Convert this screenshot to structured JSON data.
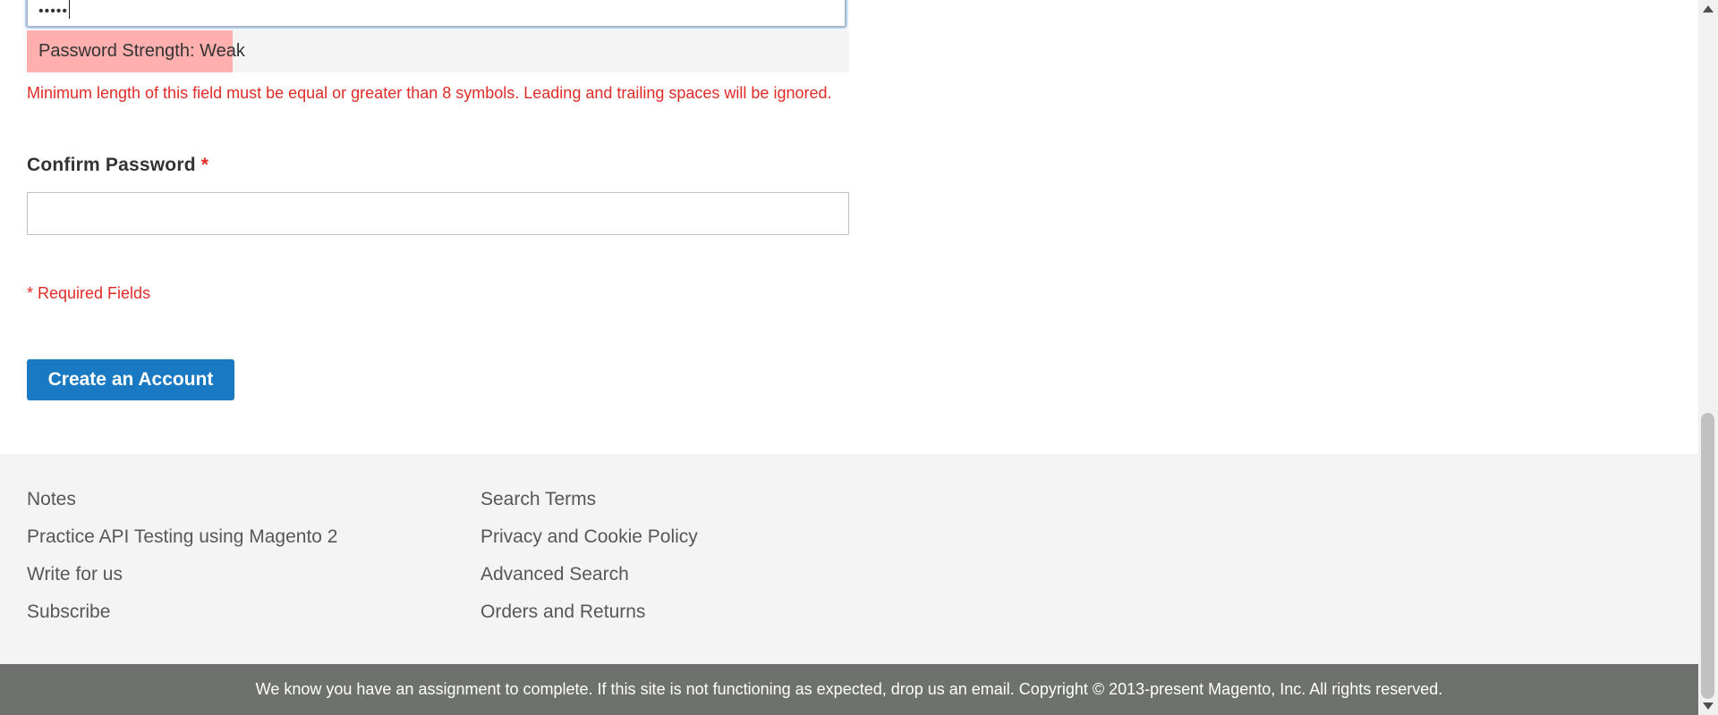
{
  "form": {
    "password_value": "•••••",
    "strength_label": "Password Strength: Weak",
    "strength_level": 0.25,
    "strength_color": "#ffafae",
    "error_message": "Minimum length of this field must be equal or greater than 8 symbols. Leading and trailing spaces will be ignored.",
    "confirm_label": "Confirm Password",
    "required_marker": "*",
    "confirm_value": "",
    "required_note": "* Required Fields",
    "submit_label": "Create an Account",
    "error_color": "#e02b27",
    "button_color": "#1979c3"
  },
  "footer": {
    "col1": [
      "Notes",
      "Practice API Testing using Magento 2",
      "Write for us",
      "Subscribe"
    ],
    "col2": [
      "Search Terms",
      "Privacy and Cookie Policy",
      "Advanced Search",
      "Orders and Returns"
    ],
    "copyright": "We know you have an assignment to complete. If this site is not functioning as expected, drop us an email. Copyright © 2013-present Magento, Inc. All rights reserved."
  },
  "icons": {
    "scroll_up": "scroll-up-arrow-icon",
    "scroll_down": "scroll-down-arrow-icon"
  }
}
